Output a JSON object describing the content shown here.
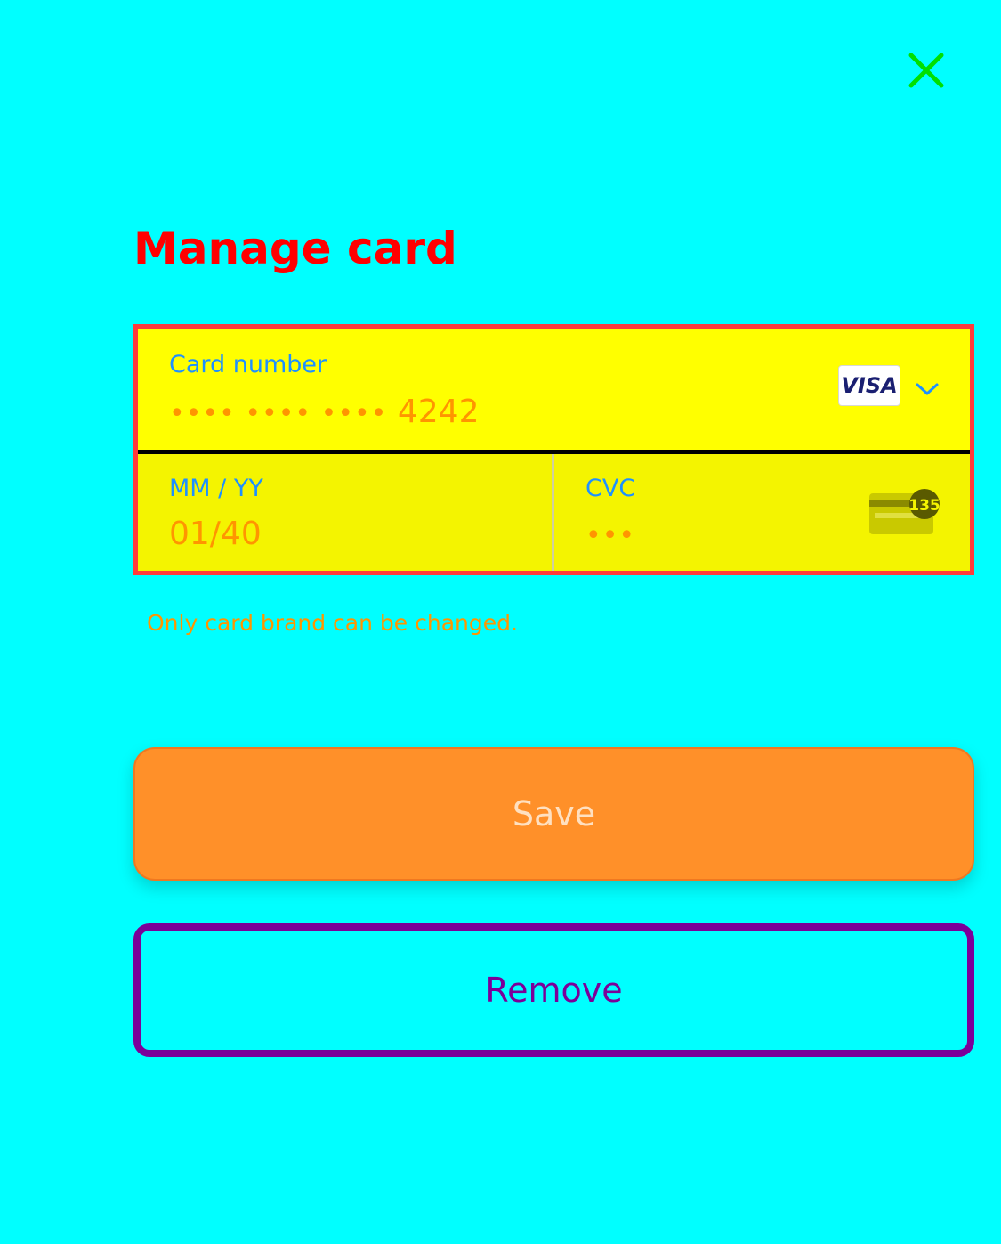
{
  "header": {
    "title": "Manage card",
    "close_icon": "close-icon"
  },
  "card": {
    "number_label": "Card number",
    "number_masked": "•••• •••• ••••",
    "number_last4": "4242",
    "brand": "VISA",
    "brand_dropdown_icon": "chevron-down-icon",
    "expiry_label": "MM / YY",
    "expiry_value": "01/40",
    "cvc_label": "CVC",
    "cvc_value": "•••",
    "cvc_icon_text": "135"
  },
  "hint": "Only card brand can be changed.",
  "actions": {
    "save_label": "Save",
    "remove_label": "Remove"
  },
  "colors": {
    "background": "#00FFFF",
    "title": "#FF0000",
    "close_icon": "#00E000",
    "field_border": "#FF3B3B",
    "field_label": "#1E90FF",
    "field_value": "#FF9500",
    "save_bg": "#FF9029",
    "remove_accent": "#7B0099"
  }
}
